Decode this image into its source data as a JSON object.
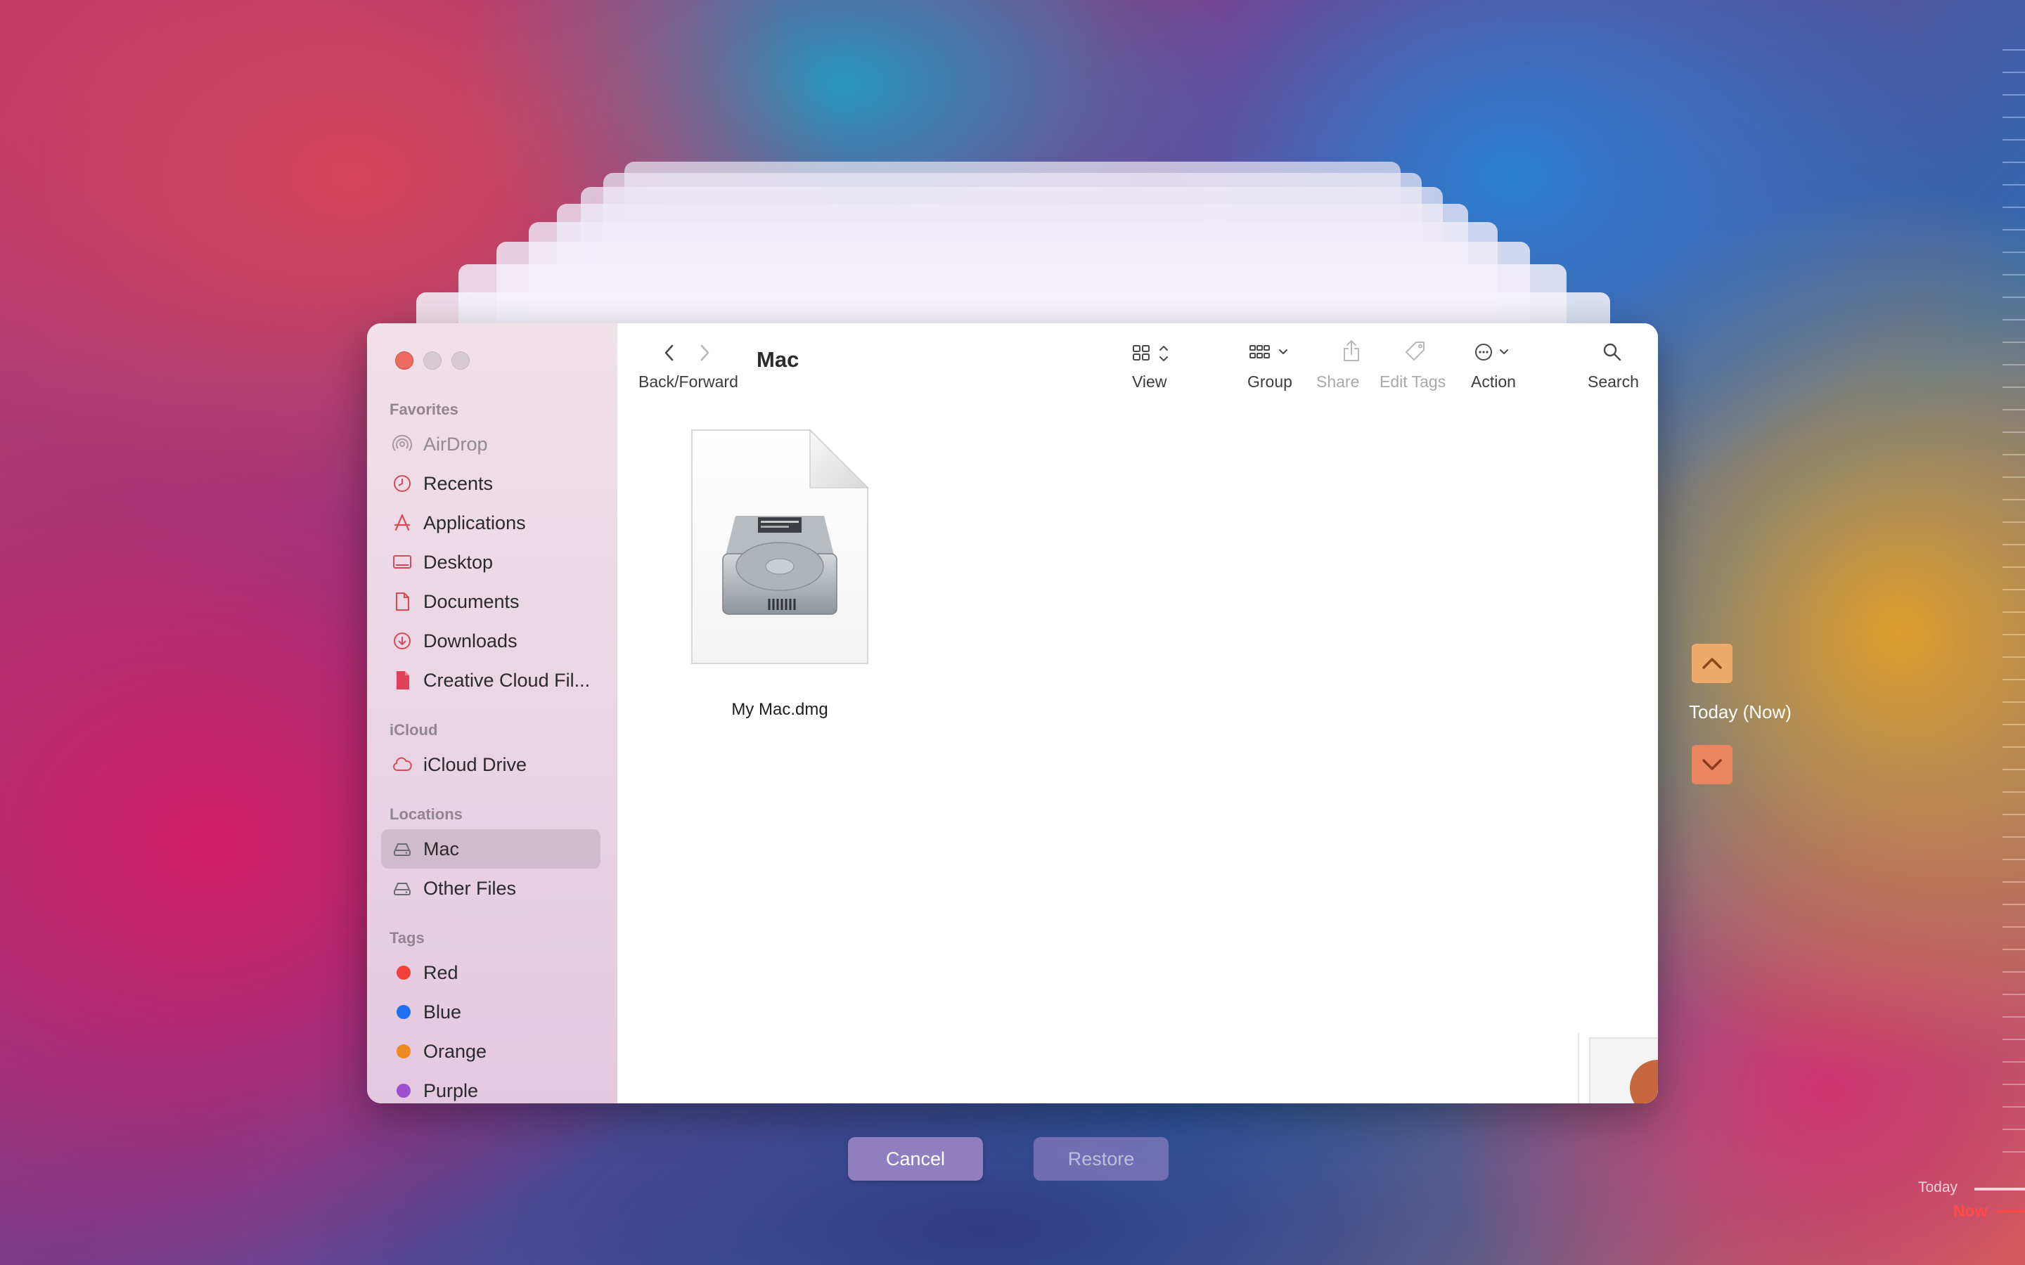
{
  "window": {
    "title": "Mac"
  },
  "toolbar": {
    "back_forward_label": "Back/Forward",
    "view_label": "View",
    "group_label": "Group",
    "share_label": "Share",
    "edit_tags_label": "Edit Tags",
    "action_label": "Action",
    "search_label": "Search"
  },
  "sidebar": {
    "favorites_header": "Favorites",
    "favorites": [
      {
        "label": "AirDrop",
        "icon": "airdrop-icon"
      },
      {
        "label": "Recents",
        "icon": "clock-icon"
      },
      {
        "label": "Applications",
        "icon": "applications-icon"
      },
      {
        "label": "Desktop",
        "icon": "desktop-icon"
      },
      {
        "label": "Documents",
        "icon": "document-icon"
      },
      {
        "label": "Downloads",
        "icon": "download-icon"
      },
      {
        "label": "Creative Cloud Fil...",
        "icon": "file-icon"
      }
    ],
    "icloud_header": "iCloud",
    "icloud": [
      {
        "label": "iCloud Drive",
        "icon": "cloud-icon"
      }
    ],
    "locations_header": "Locations",
    "locations": [
      {
        "label": "Mac",
        "icon": "drive-icon",
        "selected": true
      },
      {
        "label": "Other Files",
        "icon": "drive-icon"
      }
    ],
    "tags_header": "Tags",
    "tags": [
      {
        "label": "Red",
        "color": "#f0413a"
      },
      {
        "label": "Blue",
        "color": "#1f6ff0"
      },
      {
        "label": "Orange",
        "color": "#f08a1e"
      },
      {
        "label": "Purple",
        "color": "#9d4fd0"
      }
    ]
  },
  "files": [
    {
      "name": "My Mac.dmg",
      "icon": "disk-image-icon"
    }
  ],
  "buttons": {
    "cancel": "Cancel",
    "restore": "Restore"
  },
  "time_machine": {
    "current": "Today (Now)",
    "timeline_today": "Today",
    "timeline_now": "Now"
  },
  "colors": {
    "accent_red": "#ed6a5e",
    "sidebar_icon": "#d9475a",
    "nav_up": "#eeaa68",
    "nav_down": "#ea8562"
  }
}
